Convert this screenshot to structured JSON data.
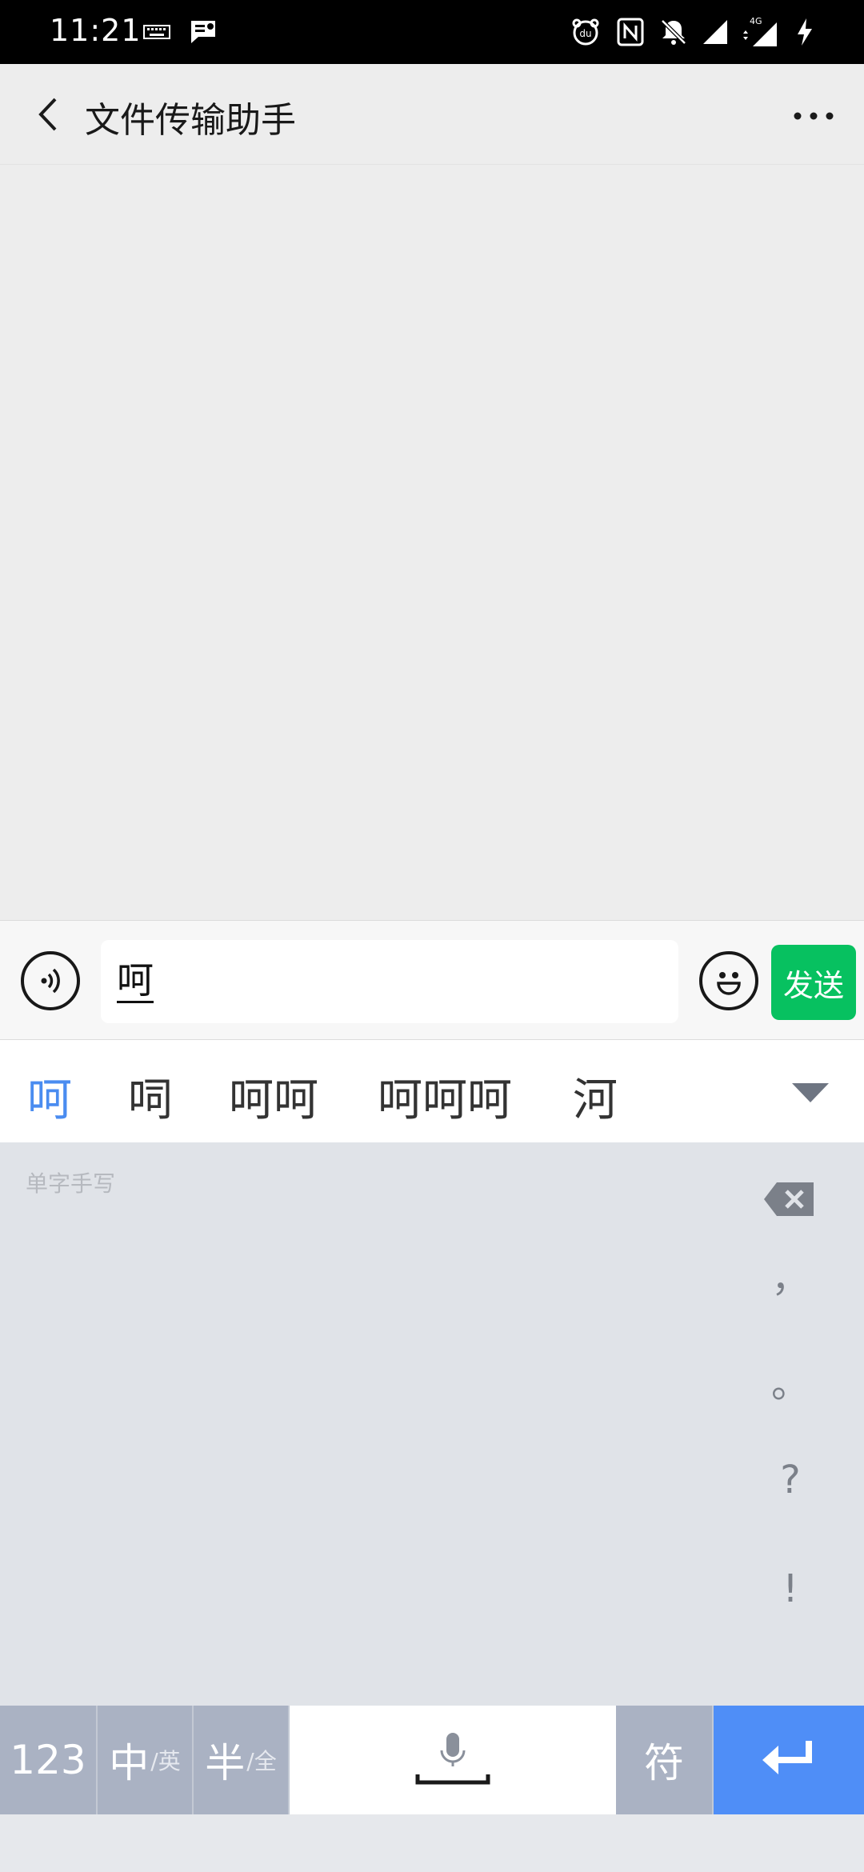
{
  "status_bar": {
    "time": "11:21",
    "icons": [
      "keyboard-icon",
      "sms-icon",
      "baidu-icon",
      "nfc-icon",
      "mute-icon",
      "signal-icon",
      "signal-4g-icon",
      "charging-icon"
    ],
    "network": "4G"
  },
  "header": {
    "title": "文件传输助手",
    "back_icon": "back-arrow-icon",
    "more_icon": "more-dots-icon"
  },
  "input_bar": {
    "text": "呵",
    "voice_icon": "voice-icon",
    "emoji_icon": "emoji-icon",
    "send_label": "发送"
  },
  "candidates": {
    "items": [
      "呵",
      "呞",
      "呵呵",
      "呵呵呵",
      "河"
    ],
    "active_index": 0,
    "expand_icon": "triangle-down-icon"
  },
  "handwriting": {
    "hint": "单字手写",
    "backspace_icon": "backspace-icon",
    "punctuation": [
      "，",
      "。",
      "?",
      "!"
    ]
  },
  "keyboard": {
    "key_123": "123",
    "key_lang_main": "中",
    "key_lang_sub": "/英",
    "key_half_main": "半",
    "key_half_sub": "/全",
    "key_space_icon": "mic-icon",
    "key_sym": "符",
    "key_enter_icon": "enter-icon"
  },
  "colors": {
    "send_green": "#07c160",
    "candidate_active": "#4a8cf0",
    "enter_blue": "#4f8ef7"
  }
}
